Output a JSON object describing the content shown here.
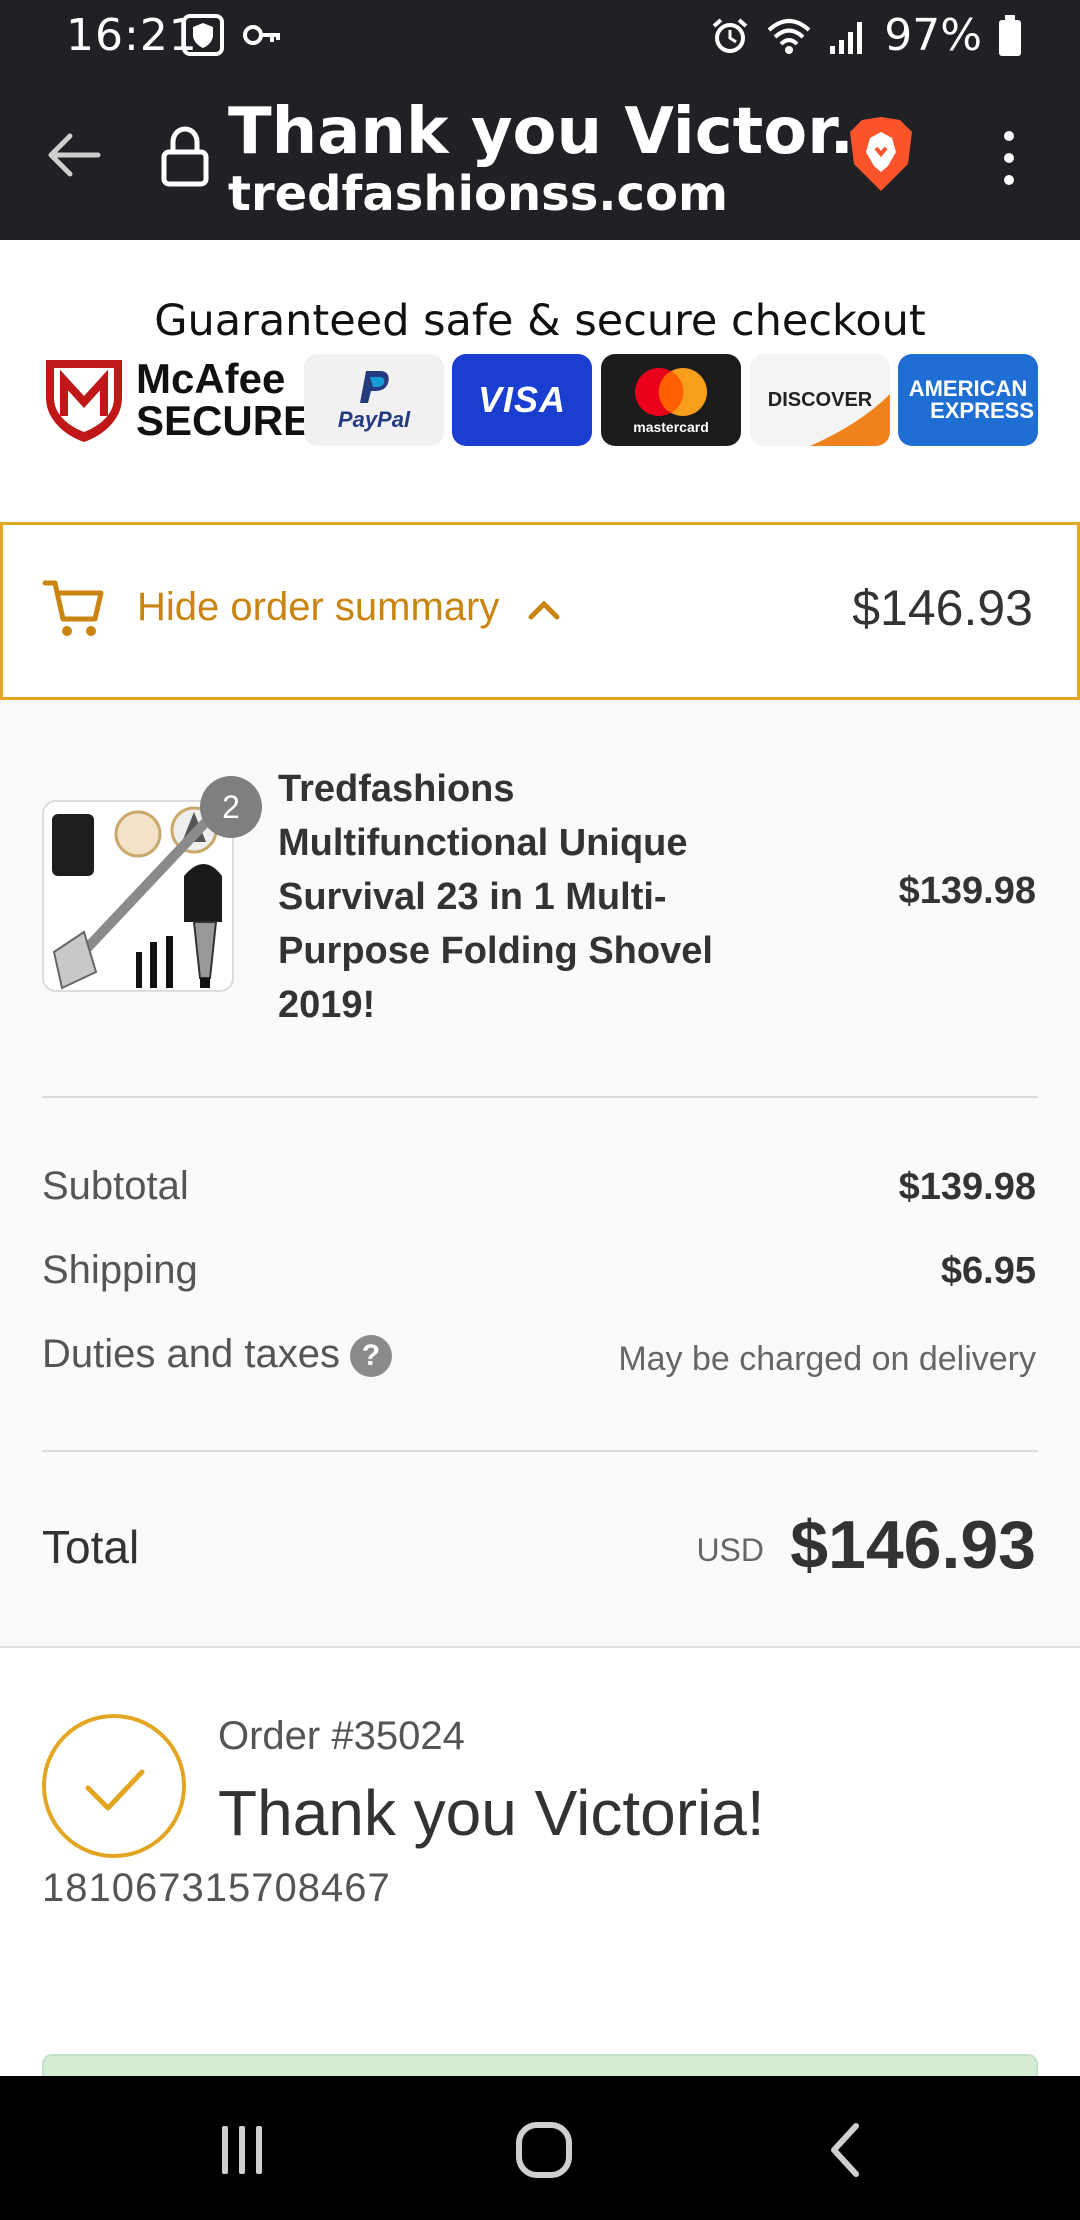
{
  "status_bar": {
    "time": "16:21",
    "battery": "97%"
  },
  "browser": {
    "page_title": "Thank you Victor...",
    "url": "tredfashionss.com"
  },
  "trust": {
    "heading": "Guaranteed safe & secure checkout",
    "mcafee_line1": "McAfee",
    "mcafee_line2": "SECURE",
    "paypal_label": "PayPal",
    "visa_label": "VISA",
    "mastercard_label": "mastercard",
    "discover_label": "DISCOVER",
    "amex_line1": "AMERICAN",
    "amex_line2": "EXPRESS"
  },
  "summary_toggle": {
    "label": "Hide order summary",
    "total": "$146.93"
  },
  "line_item": {
    "quantity": "2",
    "name": "Tredfashions Multifunctional Unique Survival 23 in 1 Multi-Purpose Folding Shovel 2019!",
    "price": "$139.98"
  },
  "totals": {
    "subtotal_label": "Subtotal",
    "subtotal_value": "$139.98",
    "shipping_label": "Shipping",
    "shipping_value": "$6.95",
    "taxes_label": "Duties and taxes",
    "taxes_help": "?",
    "taxes_note": "May be charged on delivery",
    "total_label": "Total",
    "currency": "USD",
    "total_value": "$146.93"
  },
  "confirmation": {
    "order_number": "Order #35024",
    "heading": "Thank you Victoria!",
    "order_id": "181067315708467"
  },
  "colors": {
    "accent": "#e3a623",
    "accent_text": "#c9850f",
    "toolbar_bg": "#202124"
  }
}
